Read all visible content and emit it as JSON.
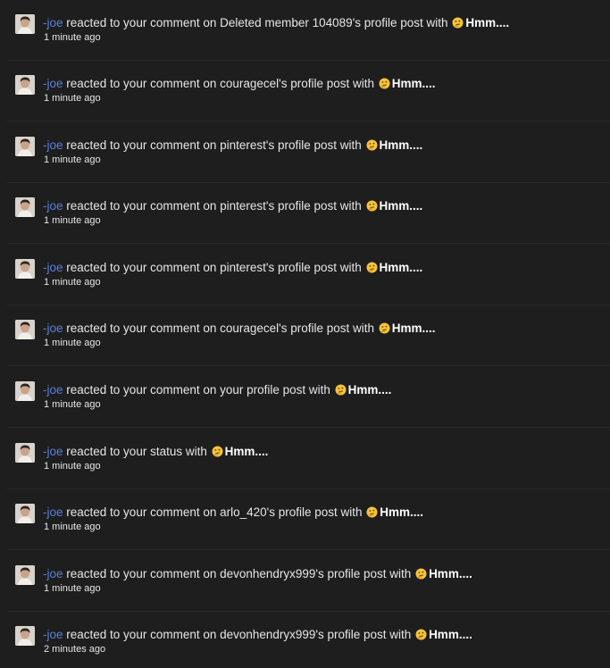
{
  "alerts": [
    {
      "user": "-joe",
      "text_before": " reacted to your comment on Deleted member 104089's profile post with ",
      "reaction_icon": "thinking-face-icon",
      "reaction": "Hmm....",
      "time": "1 minute ago"
    },
    {
      "user": "-joe",
      "text_before": " reacted to your comment on couragecel's profile post with ",
      "reaction_icon": "thinking-face-icon",
      "reaction": "Hmm....",
      "time": "1 minute ago"
    },
    {
      "user": "-joe",
      "text_before": " reacted to your comment on pinterest's profile post with ",
      "reaction_icon": "thinking-face-icon",
      "reaction": "Hmm....",
      "time": "1 minute ago"
    },
    {
      "user": "-joe",
      "text_before": " reacted to your comment on pinterest's profile post with ",
      "reaction_icon": "thinking-face-icon",
      "reaction": "Hmm....",
      "time": "1 minute ago"
    },
    {
      "user": "-joe",
      "text_before": " reacted to your comment on pinterest's profile post with ",
      "reaction_icon": "thinking-face-icon",
      "reaction": "Hmm....",
      "time": "1 minute ago"
    },
    {
      "user": "-joe",
      "text_before": " reacted to your comment on couragecel's profile post with ",
      "reaction_icon": "thinking-face-icon",
      "reaction": "Hmm....",
      "time": "1 minute ago"
    },
    {
      "user": "-joe",
      "text_before": " reacted to your comment on your profile post with ",
      "reaction_icon": "thinking-face-icon",
      "reaction": "Hmm....",
      "time": "1 minute ago"
    },
    {
      "user": "-joe",
      "text_before": " reacted to your status with ",
      "reaction_icon": "thinking-face-icon",
      "reaction": "Hmm....",
      "time": "1 minute ago"
    },
    {
      "user": "-joe",
      "text_before": " reacted to your comment on arlo_420's profile post with ",
      "reaction_icon": "thinking-face-icon",
      "reaction": "Hmm....",
      "time": "1 minute ago"
    },
    {
      "user": "-joe",
      "text_before": " reacted to your comment on devonhendryx999's profile post with ",
      "reaction_icon": "thinking-face-icon",
      "reaction": "Hmm....",
      "time": "1 minute ago"
    },
    {
      "user": "-joe",
      "text_before": " reacted to your comment on devonhendryx999's profile post with ",
      "reaction_icon": "thinking-face-icon",
      "reaction": "Hmm....",
      "time": "2 minutes ago"
    }
  ],
  "colors": {
    "background": "#1e1e1e",
    "username": "#5b7fd6",
    "text": "#e6e6e6",
    "divider": "#2a2a2a",
    "reaction_face": "#f5c33b"
  }
}
